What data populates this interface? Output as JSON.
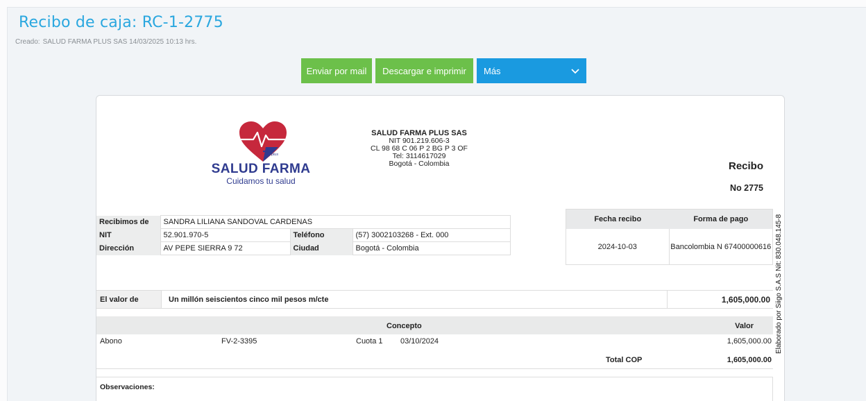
{
  "header": {
    "title": "Recibo de caja: RC-1-2775",
    "created_label": "Creado:",
    "created_value": "SALUD FARMA PLUS SAS 14/03/2025 10:13 hrs."
  },
  "actions": {
    "email_label": "Enviar por mail",
    "print_label": "Descargar e imprimir",
    "more_label": "Más"
  },
  "logo": {
    "brand": "SALUD FARMA",
    "slogan": "Cuidamos tu salud",
    "plus_mark": "plus"
  },
  "company": {
    "name": "SALUD FARMA PLUS SAS",
    "nit": "NIT 901.219.606-3",
    "address": "CL 98 68 C 06 P 2 BG P 3 OF",
    "phone": "Tel: 3114617029",
    "city": "Bogotá - Colombia"
  },
  "receipt": {
    "title": "Recibo",
    "number": "No 2775",
    "side_note": "Elaborado por Siigo S.A.S Nit: 830.048.145-8"
  },
  "payer": {
    "received_label": "Recibimos de",
    "received_value": "SANDRA LILIANA SANDOVAL CARDENAS",
    "nit_label": "NIT",
    "nit_value": "52.901.970-5",
    "phone_label": "Teléfono",
    "phone_value": "(57) 3002103268 - Ext. 000",
    "address_label": "Dirección",
    "address_value": "AV PEPE SIERRA 9 72",
    "city_label": "Ciudad",
    "city_value": "Bogotá - Colombia"
  },
  "payment": {
    "date_label": "Fecha recibo",
    "date_value": "2024-10-03",
    "method_label": "Forma de pago",
    "method_value": "Bancolombia N 67400000616"
  },
  "amount": {
    "label": "El valor de",
    "words": "Un millón seiscientos cinco mil pesos m/cte",
    "value": "1,605,000.00"
  },
  "concepts": {
    "concept_header": "Concepto",
    "value_header": "Valor",
    "rows": [
      {
        "type": "Abono",
        "doc": "FV-2-3395",
        "installment": "Cuota 1",
        "date": "03/10/2024",
        "value": "1,605,000.00"
      }
    ],
    "total_label": "Total COP",
    "total_value": "1,605,000.00"
  },
  "observations": {
    "label": "Observaciones:"
  },
  "colors": {
    "title_blue": "#2aa7df",
    "button_green": "#6cc04a",
    "button_blue": "#1a9ae0",
    "brand_navy": "#2f3b8f",
    "heart_red": "#c6283c"
  }
}
